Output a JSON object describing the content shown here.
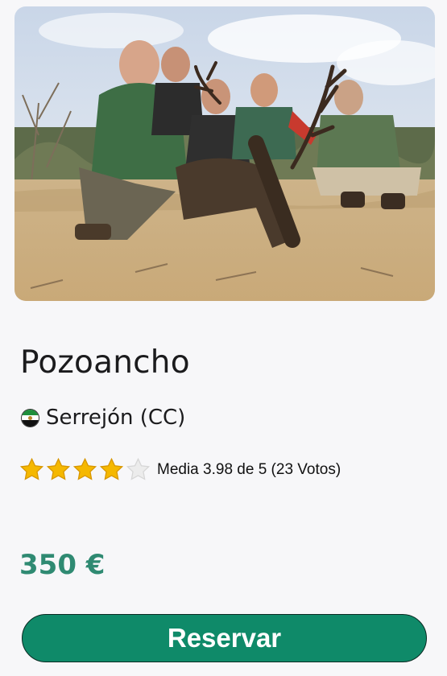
{
  "listing": {
    "title": "Pozoancho",
    "location": "Serrejón (CC)",
    "flag_icon": "extremadura-flag-icon",
    "rating": {
      "value": 3.98,
      "max": 5,
      "text": "Media 3.98 de 5 (23 Votos)",
      "filled_stars": 4,
      "total_stars": 5,
      "star_color": "#f5b800",
      "empty_star_color": "#ececec"
    },
    "price": "350 €",
    "reserve_label": "Reservar"
  },
  "colors": {
    "price": "#2f8a72",
    "button": "#0f8a69",
    "background": "#f7f7f9"
  }
}
